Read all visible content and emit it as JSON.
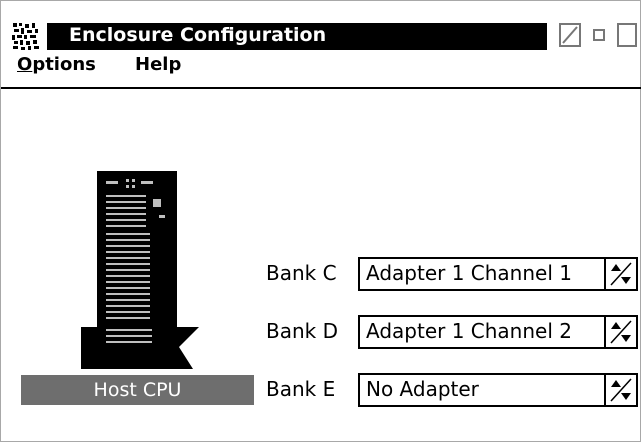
{
  "window": {
    "title": "Enclosure Configuration"
  },
  "menu": {
    "options": {
      "mnemonic": "O",
      "rest": "ptions"
    },
    "help": "Help"
  },
  "host": {
    "label": "Host CPU"
  },
  "banks": [
    {
      "label": "Bank C",
      "value": "Adapter 1 Channel 1"
    },
    {
      "label": "Bank D",
      "value": "Adapter 1 Channel 2"
    },
    {
      "label": "Bank E",
      "value": "No Adapter"
    }
  ],
  "icons": {
    "system_menu": "system-menu-icon",
    "minimize": "minimize-icon",
    "restore": "restore-icon",
    "maximize": "maximize-icon",
    "spin": "spin-arrows-icon",
    "computer": "computer-tower-icon"
  }
}
